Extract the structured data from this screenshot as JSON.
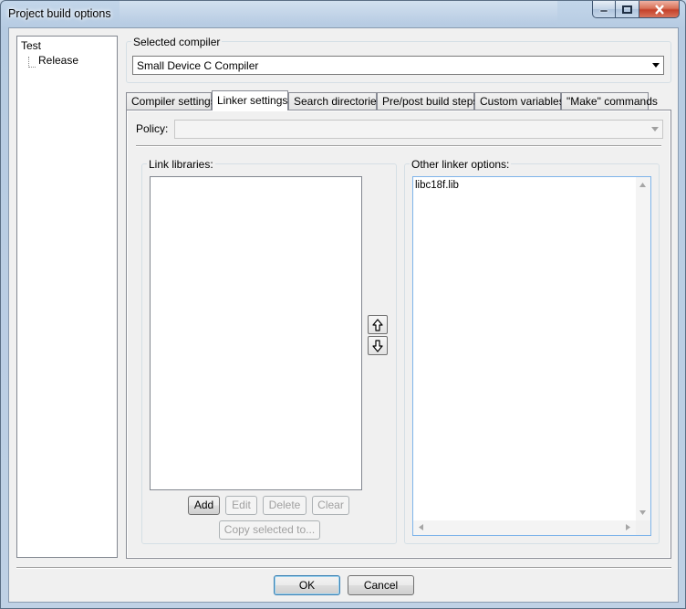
{
  "window": {
    "title": "Project build options"
  },
  "tree": {
    "root": "Test",
    "child": "Release"
  },
  "compiler": {
    "group_label": "Selected compiler",
    "selected": "Small Device C Compiler"
  },
  "tabs": [
    {
      "label": "Compiler settings"
    },
    {
      "label": "Linker settings"
    },
    {
      "label": "Search directories"
    },
    {
      "label": "Pre/post build steps"
    },
    {
      "label": "Custom variables"
    },
    {
      "label": "\"Make\" commands"
    }
  ],
  "active_tab": "Linker settings",
  "policy": {
    "label": "Policy:",
    "value": ""
  },
  "link_libraries": {
    "group_label": "Link libraries:",
    "items": [],
    "buttons": {
      "add": "Add",
      "edit": "Edit",
      "delete": "Delete",
      "clear": "Clear",
      "copy": "Copy selected to..."
    }
  },
  "other_linker": {
    "group_label": "Other linker options:",
    "text": "libc18f.lib"
  },
  "dialog_buttons": {
    "ok": "OK",
    "cancel": "Cancel"
  },
  "colors": {
    "accent": "#3c7fb1",
    "close": "#c4412a"
  }
}
